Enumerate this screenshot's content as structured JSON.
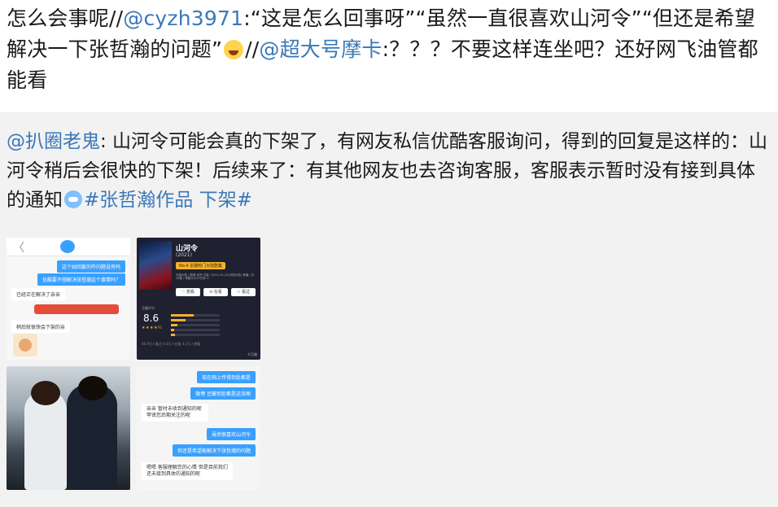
{
  "post": {
    "seg1": "怎么会事呢//",
    "mention1": "@cyzh3971",
    "seg2": ":“这是怎么回事呀”“虽然一直很喜欢山河令”“但还是希望解决一下张哲瀚的问题”",
    "emoji1": "laughing-face-emoji",
    "seg3": "//",
    "mention2": "@超大号摩卡",
    "seg4": ":？？？不要这样连坐吧？还好网飞油管都能看"
  },
  "repost": {
    "mention": "@扒圈老鬼",
    "body": ": 山河令可能会真的下架了，有网友私信优酷客服询问，得到的回复是这样的：山河令稍后会很快的下架！后续来了：有其他网友也去咨询客服，客服表示暂时没有接到具体的通知",
    "emoji": "doraemon-emoji",
    "hashtag": "#张哲瀚作品 下架#"
  },
  "thumbs": {
    "chat1": {
      "back": "〈",
      "msg1": "这个姑回套的咋问题没有吗",
      "msg2": "优酷要不想解决张哲瀚这个事情吗？",
      "msg3": "已经正在解决了亲亲",
      "msg4": "稍后就很快会下架的亲"
    },
    "movie": {
      "title": "山河令",
      "year": "(2021)",
      "rank": "No.4 近期热门大陆剧集",
      "meta": "中国大陆 / 剧情 武侠 古装 / 2021-02-22(中国大陆) 首播 / 共36集 / 单集片长45分钟 >",
      "btn1": "♡ 想看",
      "btn2": "⊙ 在看",
      "btn3": "☆ 看过",
      "score_label": "豆瓣评分",
      "score": "8.6",
      "stars": "★★★★½",
      "foot": "46.9万人看过  6.6万人在看  4.2万人想看",
      "watermark": "©豆瓣"
    },
    "chat2": {
      "msg1": "现在网上传得到处都是",
      "msg2": "微博 豆瓣到处都是这张图",
      "msg3": "亲亲 暂时未收到通知的呢 甲贤您后期关注的呢",
      "msg4": "虽然很喜欢山河令",
      "msg5": "但还是希望能解决下张哲瀚的问题",
      "msg6": "嗯嗯 客服理解您的心情 但是目前我们还未接到具体的通知的呢"
    }
  },
  "colors": {
    "link": "#3a78b8",
    "repost_bg": "#f2f2f2",
    "chat_blue": "#3aa0ff"
  }
}
